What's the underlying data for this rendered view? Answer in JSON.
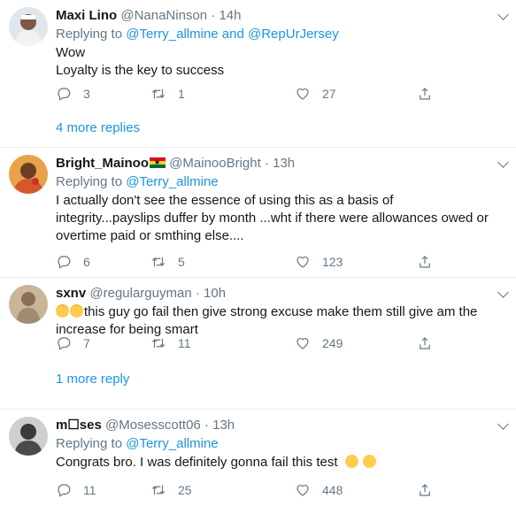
{
  "tweets": [
    {
      "name": "Maxi Lino",
      "handle": "@NanaNinson",
      "time": "14h",
      "replying_prefix": "Replying to",
      "replying_to": "@Terry_allmine and @RepUrJersey",
      "text": "Wow\nLoyalty is the key to success",
      "replies": "3",
      "retweets": "1",
      "likes": "27",
      "more_replies": "4 more replies"
    },
    {
      "name": "Bright_Mainoo",
      "handle": "@MainooBright",
      "time": "13h",
      "replying_prefix": "Replying to",
      "replying_to": "@Terry_allmine",
      "text": "I actually don't see the essence of using this as a basis of integrity...payslips duffer by month ...wht if there were allowances owed or overtime paid or smthing else....",
      "replies": "6",
      "retweets": "5",
      "likes": "123"
    },
    {
      "name": "sxnv",
      "handle": "@regularguyman",
      "time": "10h",
      "text": "this guy go fail then give strong excuse make them still give am the increase for being smart",
      "replies": "7",
      "retweets": "11",
      "likes": "249",
      "more_replies": "1 more reply"
    },
    {
      "name": "m☐ses",
      "handle": "@Mosesscott06",
      "time": "13h",
      "replying_prefix": "Replying to",
      "replying_to": "@Terry_allmine",
      "text": "Congrats bro. I was definitely gonna fail this test",
      "replies": "11",
      "retweets": "25",
      "likes": "448"
    }
  ],
  "separator_dot": "·",
  "colors": {
    "link": "#1b95e0",
    "muted": "#657786",
    "divider": "#e6ecf0"
  },
  "icons": [
    "reply-icon",
    "retweet-icon",
    "like-icon",
    "share-icon",
    "chevron-down-icon"
  ]
}
